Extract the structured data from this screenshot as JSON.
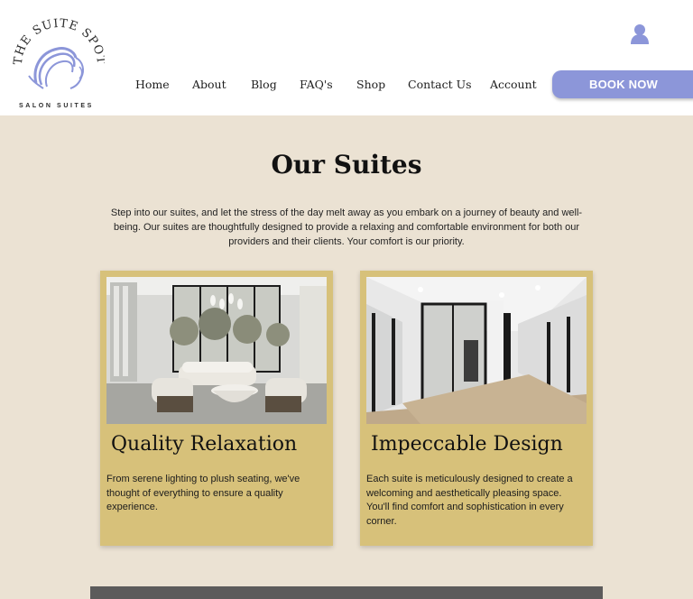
{
  "logo": {
    "arc_text": "THE SUITE SPOT",
    "subtitle": "SALON SUITES",
    "brand_color": "#8c96d9"
  },
  "nav": {
    "items": [
      {
        "label": "Home"
      },
      {
        "label": "About"
      },
      {
        "label": "Blog"
      },
      {
        "label": "FAQ's"
      },
      {
        "label": "Shop"
      },
      {
        "label": "Contact Us"
      },
      {
        "label": "Account"
      }
    ]
  },
  "header": {
    "book_button": "BOOK NOW",
    "account_icon": "user-icon"
  },
  "main": {
    "title": "Our Suites",
    "intro": "Step into our suites, and let the stress of the day melt away as you embark on a journey of beauty and well-being. Our suites are thoughtfully designed to provide a relaxing and comfortable environment for both our providers and their clients. Your comfort is our priority.",
    "cards": [
      {
        "title": "Quality Relaxation",
        "text": "From serene lighting to plush seating, we've thought of everything to ensure a quality experience.",
        "image": "lounge-photo"
      },
      {
        "title": "Impeccable Design",
        "text": "Each suite is meticulously designed to create a welcoming and aesthetically pleasing space. You'll find comfort and sophistication in every corner.",
        "image": "hallway-photo"
      }
    ]
  },
  "colors": {
    "accent": "#8c96d9",
    "card": "#d7c17a",
    "section_bg": "#ebe2d3",
    "footer_bar": "#5c5b5b"
  }
}
